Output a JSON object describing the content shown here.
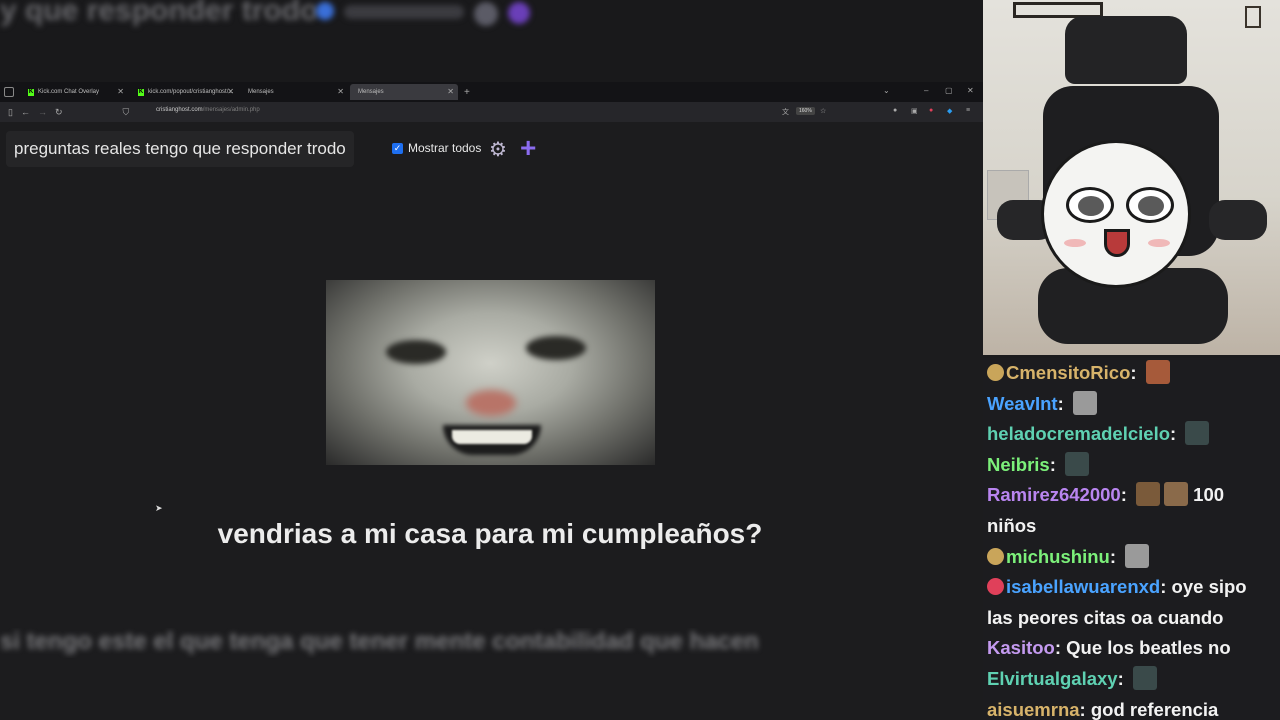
{
  "blurred_top_text": "y que responder trodo",
  "browser": {
    "tabs": [
      {
        "label": "Kick.com Chat Overlay",
        "active": false
      },
      {
        "label": "kick.com/popout/cristianghost/...",
        "active": false
      },
      {
        "label": "Mensajes",
        "active": false
      },
      {
        "label": "Mensajes",
        "active": true
      }
    ],
    "url_host": "cristianghost.com",
    "url_path": "/mensajes/admin.php",
    "zoom": "160%"
  },
  "page": {
    "message_input_value": "preguntas reales tengo que responder trodo",
    "show_all_label": "Mostrar todos",
    "show_all_checked": true,
    "question": "vendrias a mi casa para mi cumpleaños?"
  },
  "blurred_bottom_text": "si tengo este el que tenga que tener mente contabilidad que hacen",
  "colors": {
    "accent_purple": "#8b6cf0",
    "kick_green": "#53fc18",
    "checkbox_blue": "#1e6ff0"
  },
  "chat": {
    "messages": [
      {
        "badge": "#c9a55a",
        "user": "CmensitoRico",
        "color": "#d7b36a",
        "sep": ":",
        "text": "",
        "emotes": [
          "#a65a3a"
        ]
      },
      {
        "badge": "",
        "user": "WeavInt",
        "color": "#4aa3ff",
        "sep": ":",
        "text": "",
        "emotes": [
          "#9a9a9a"
        ]
      },
      {
        "badge": "",
        "user": "heladocremadelcielo",
        "color": "#5fd1b2",
        "sep": ":",
        "text": "",
        "emotes": [
          "#3a4a4a"
        ]
      },
      {
        "badge": "",
        "user": "Neibris",
        "color": "#7cf07a",
        "sep": ":",
        "text": "",
        "emotes": [
          "#3a4a4a"
        ]
      },
      {
        "badge": "",
        "user": "Ramirez642000",
        "color": "#b985f0",
        "sep": ":",
        "text": "100",
        "emotes": [
          "#7a5a3a",
          "#8a6a4a"
        ]
      },
      {
        "badge": "",
        "user": "",
        "color": "#f2f2f2",
        "sep": "",
        "text": "niños",
        "emotes": []
      },
      {
        "badge": "#c9a55a",
        "user": "michushinu",
        "color": "#7cf07a",
        "sep": ":",
        "text": "",
        "emotes": [
          "#9a9a9a"
        ]
      },
      {
        "badge": "#e0405a",
        "user": "isabellawuarenxd",
        "color": "#4aa3ff",
        "sep": ":",
        "text": "oye sipo",
        "emotes": []
      },
      {
        "badge": "",
        "user": "",
        "color": "#f2f2f2",
        "sep": "",
        "text": "las peores citas oa cuando",
        "emotes": []
      },
      {
        "badge": "",
        "user": "Kasitoo",
        "color": "#c49af0",
        "sep": ":",
        "text": "Que los beatles no",
        "emotes": []
      },
      {
        "badge": "",
        "user": "Elvirtualgalaxy",
        "color": "#5fd1b2",
        "sep": ":",
        "text": "",
        "emotes": [
          "#3a4a4a"
        ]
      },
      {
        "badge": "",
        "user": "aisuemrna",
        "color": "#d7b36a",
        "sep": ":",
        "text": "god referencia",
        "emotes": []
      }
    ]
  }
}
